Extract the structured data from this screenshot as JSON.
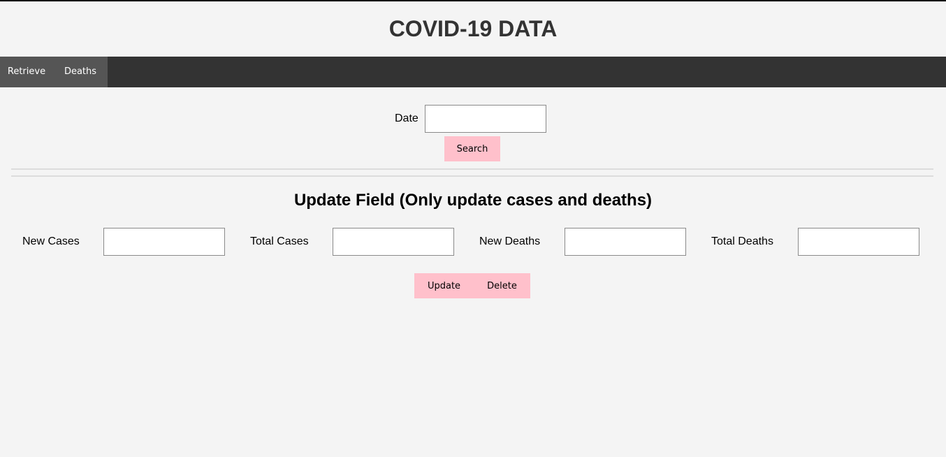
{
  "header": {
    "title": "COVID-19 DATA"
  },
  "nav": {
    "items": [
      {
        "label": "Retrieve"
      },
      {
        "label": "Deaths"
      }
    ]
  },
  "search": {
    "date_label": "Date",
    "date_value": "",
    "button_label": "Search"
  },
  "update": {
    "heading": "Update Field (Only update cases and deaths)",
    "fields": [
      {
        "label": "New Cases",
        "value": ""
      },
      {
        "label": "Total Cases",
        "value": ""
      },
      {
        "label": "New Deaths",
        "value": ""
      },
      {
        "label": "Total Deaths",
        "value": ""
      }
    ],
    "update_button_label": "Update",
    "delete_button_label": "Delete"
  },
  "colors": {
    "background": "#f4f4f4",
    "navbar": "#333333",
    "nav_item": "#555555",
    "button": "#ffc0cb",
    "title_text": "#333333"
  }
}
